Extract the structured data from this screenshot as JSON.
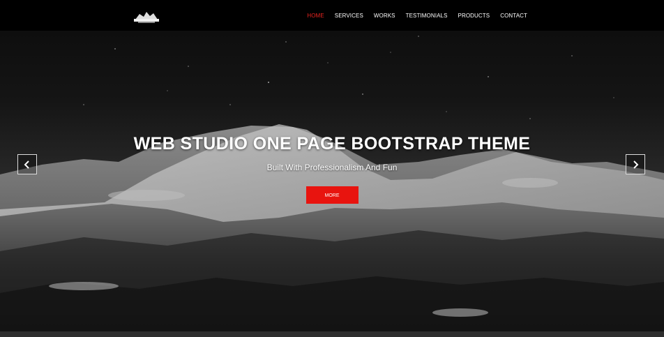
{
  "navbar": {
    "logo_icon": "logo-emblem-icon",
    "items": [
      {
        "label": "HOME",
        "active": true
      },
      {
        "label": "SERVICES",
        "active": false
      },
      {
        "label": "WORKS",
        "active": false
      },
      {
        "label": "TESTIMONIALS",
        "active": false
      },
      {
        "label": "PRODUCTS",
        "active": false
      },
      {
        "label": "CONTACT",
        "active": false
      }
    ]
  },
  "hero": {
    "title": "WEB STUDIO ONE PAGE BOOTSTRAP THEME",
    "subtitle": "Built With Professionalism And Fun",
    "button_label": "MORE",
    "prev_icon": "chevron-left-icon",
    "next_icon": "chevron-right-icon",
    "background": "snowy-mountain-night-image"
  },
  "colors": {
    "accent": "#e8140f",
    "active_nav": "#e8231f",
    "navbar_bg": "#000000"
  }
}
